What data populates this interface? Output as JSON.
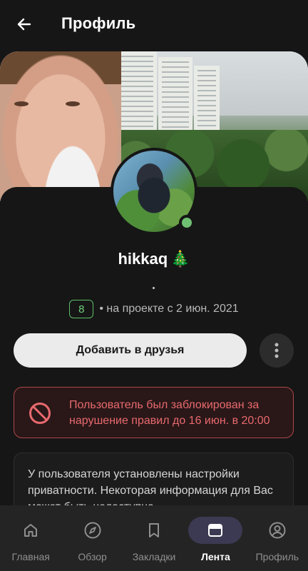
{
  "appbar": {
    "title": "Профиль"
  },
  "profile": {
    "username": "hikkaq",
    "username_emoji": "🎄",
    "status_text": ".",
    "level": "8",
    "joined": "• на проекте с 2 июн. 2021",
    "online": true
  },
  "actions": {
    "add_friend_label": "Добавить в друзья"
  },
  "ban_notice": {
    "text": "Пользователь был заблокирован за нарушение правил до 16 июн. в 20:00",
    "color": "#e86a6e"
  },
  "privacy_notice": {
    "text": "У пользователя установлены настройки приватности. Некоторая информация для Вас может быть недоступна"
  },
  "bottom_nav": {
    "items": [
      {
        "label": "Главная",
        "icon": "home-icon",
        "active": false
      },
      {
        "label": "Обзор",
        "icon": "compass-icon",
        "active": false
      },
      {
        "label": "Закладки",
        "icon": "bookmark-icon",
        "active": false
      },
      {
        "label": "Лента",
        "icon": "feed-icon",
        "active": true
      },
      {
        "label": "Профиль",
        "icon": "profile-icon",
        "active": false
      }
    ]
  },
  "colors": {
    "background": "#161616",
    "accent_green": "#6fd07a",
    "active_nav_pill": "#3c3a52"
  }
}
